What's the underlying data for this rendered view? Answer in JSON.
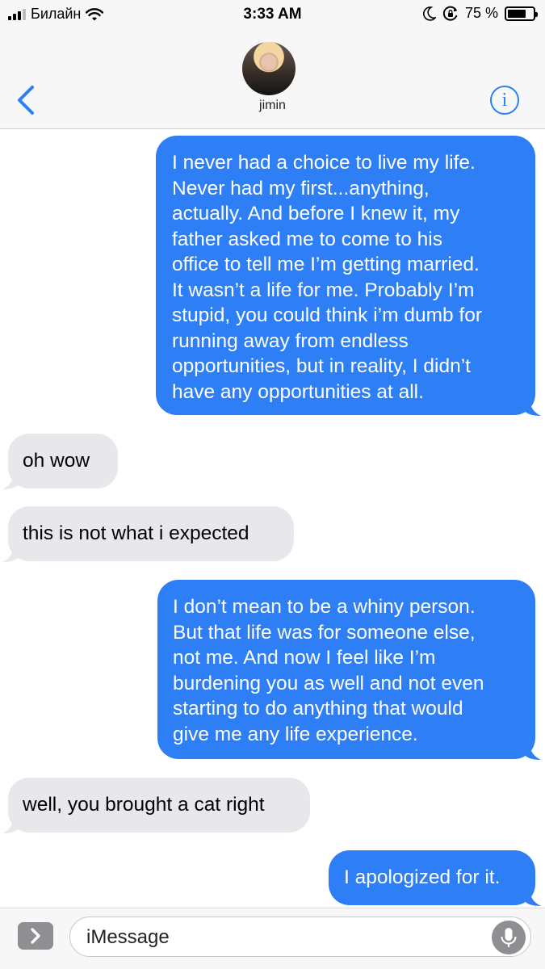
{
  "status_bar": {
    "carrier": "Билайн",
    "time": "3:33 AM",
    "battery_percent": "75 %",
    "battery_level": 0.75,
    "icons": [
      "signal-icon",
      "wifi-icon",
      "moon-icon",
      "rotation-lock-icon",
      "battery-icon"
    ]
  },
  "header": {
    "contact_name": "jimin",
    "back_icon": "chevron-left-icon",
    "info_icon": "info-icon",
    "info_glyph": "i"
  },
  "messages": [
    {
      "direction": "outgoing",
      "lines": [
        "I never had a choice to live my life.",
        "Never had my first...anything,",
        "actually. And before I knew it, my",
        "father asked me to come to his",
        "office to tell me I’m getting married.",
        "It wasn’t a life for me. Probably I’m",
        "stupid, you could think i’m dumb for",
        "running away from endless",
        "opportunities, but in reality, I didn’t",
        "have any opportunities at all."
      ]
    },
    {
      "direction": "incoming",
      "lines": [
        "oh wow"
      ]
    },
    {
      "direction": "incoming",
      "lines": [
        "this is not what i expected"
      ]
    },
    {
      "direction": "outgoing",
      "lines": [
        "I don’t mean to be a whiny person.",
        "But that life was for someone else,",
        "not me. And now I feel like I’m",
        "burdening you as well and not even",
        "starting to do anything that would",
        "give me any life experience."
      ]
    },
    {
      "direction": "incoming",
      "lines": [
        "well, you brought a cat right"
      ]
    },
    {
      "direction": "outgoing",
      "lines": [
        "I apologized for it."
      ]
    }
  ],
  "input_bar": {
    "placeholder": "iMessage",
    "expand_icon": "chevron-right-icon",
    "mic_icon": "microphone-icon"
  },
  "colors": {
    "outgoing_bubble": "#2e7ff5",
    "incoming_bubble": "#e8e8ec",
    "accent": "#2d7ff6",
    "bar_background": "#f7f7f7"
  }
}
